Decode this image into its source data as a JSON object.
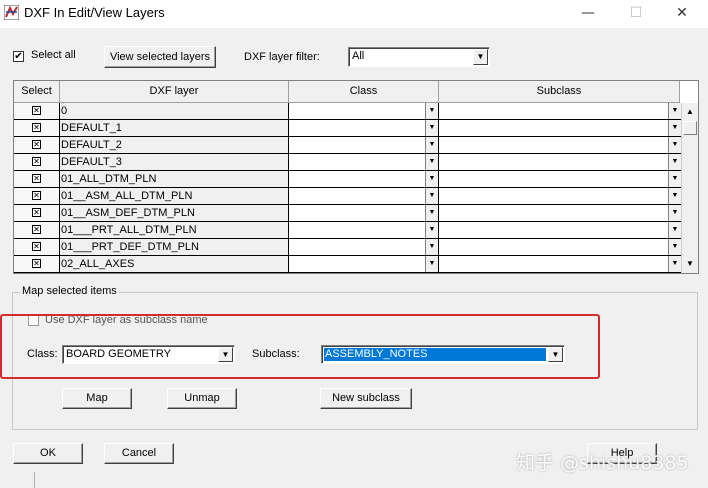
{
  "window": {
    "title": "DXF In Edit/View Layers",
    "minimize": "—",
    "maximize": "☐",
    "close": "✕"
  },
  "toolbar": {
    "select_all_label": "Select all",
    "select_all_checked": true,
    "view_selected_label": "View selected layers",
    "filter_label": "DXF layer filter:",
    "filter_value": "All"
  },
  "grid": {
    "columns": [
      "Select",
      "DXF layer",
      "Class",
      "Subclass"
    ],
    "rows": [
      {
        "selected": true,
        "layer": "0",
        "class": "",
        "subclass": ""
      },
      {
        "selected": true,
        "layer": "DEFAULT_1",
        "class": "",
        "subclass": ""
      },
      {
        "selected": true,
        "layer": "DEFAULT_2",
        "class": "",
        "subclass": ""
      },
      {
        "selected": true,
        "layer": "DEFAULT_3",
        "class": "",
        "subclass": ""
      },
      {
        "selected": true,
        "layer": "01_ALL_DTM_PLN",
        "class": "",
        "subclass": ""
      },
      {
        "selected": true,
        "layer": "01__ASM_ALL_DTM_PLN",
        "class": "",
        "subclass": ""
      },
      {
        "selected": true,
        "layer": "01__ASM_DEF_DTM_PLN",
        "class": "",
        "subclass": ""
      },
      {
        "selected": true,
        "layer": "01___PRT_ALL_DTM_PLN",
        "class": "",
        "subclass": ""
      },
      {
        "selected": true,
        "layer": "01___PRT_DEF_DTM_PLN",
        "class": "",
        "subclass": ""
      },
      {
        "selected": true,
        "layer": "02_ALL_AXES",
        "class": "",
        "subclass": ""
      }
    ]
  },
  "map_section": {
    "legend": "Map selected items",
    "use_dxf_label": "Use DXF layer as subclass name",
    "use_dxf_checked": false,
    "class_label": "Class:",
    "class_value": "BOARD GEOMETRY",
    "subclass_label": "Subclass:",
    "subclass_value": "ASSEMBLY_NOTES",
    "map_button": "Map",
    "unmap_button": "Unmap",
    "new_subclass_button": "New subclass"
  },
  "footer": {
    "ok_button": "OK",
    "cancel_button": "Cancel",
    "help_button": "Help"
  },
  "watermark": "知乎 @shishu8385",
  "colors": {
    "highlight_border": "#d42b2b",
    "selection_blue": "#0078d7"
  },
  "icons": {
    "app": "dxf-app-icon",
    "dropdown": "chevron-down-icon",
    "check": "checkmark-icon"
  }
}
